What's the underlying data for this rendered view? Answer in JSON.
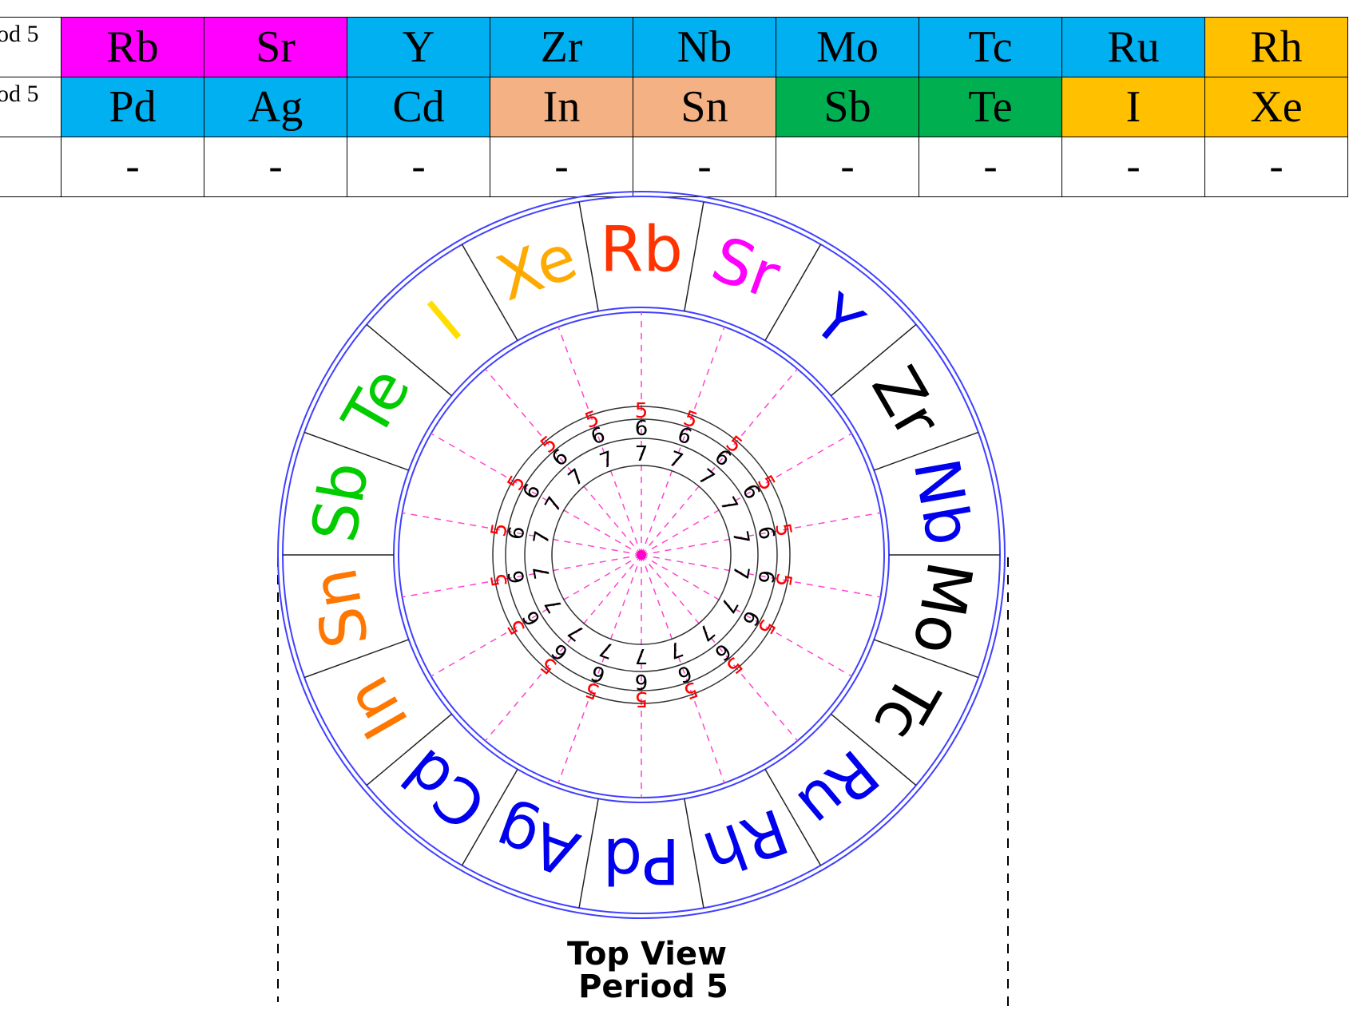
{
  "table": {
    "rows": [
      {
        "label": "od 5",
        "cells": [
          {
            "text": "Rb",
            "color": "#ff00ff"
          },
          {
            "text": "Sr",
            "color": "#ff00ff"
          },
          {
            "text": "Y",
            "color": "#00b0f0"
          },
          {
            "text": "Zr",
            "color": "#00b0f0"
          },
          {
            "text": "Nb",
            "color": "#00b0f0"
          },
          {
            "text": "Mo",
            "color": "#00b0f0"
          },
          {
            "text": "Tc",
            "color": "#00b0f0"
          },
          {
            "text": "Ru",
            "color": "#00b0f0"
          },
          {
            "text": "Rh",
            "color": "#ffc000"
          }
        ]
      },
      {
        "label": "od 5",
        "cells": [
          {
            "text": "Pd",
            "color": "#00b0f0"
          },
          {
            "text": "Ag",
            "color": "#00b0f0"
          },
          {
            "text": "Cd",
            "color": "#00b0f0"
          },
          {
            "text": "In",
            "color": "#f4b183"
          },
          {
            "text": "Sn",
            "color": "#f4b183"
          },
          {
            "text": "Sb",
            "color": "#00b050"
          },
          {
            "text": "Te",
            "color": "#00b050"
          },
          {
            "text": "I",
            "color": "#ffc000"
          },
          {
            "text": "Xe",
            "color": "#ffc000"
          }
        ]
      },
      {
        "label": "",
        "cells": [
          {
            "text": "-",
            "color": "#ffffff"
          },
          {
            "text": "-",
            "color": "#ffffff"
          },
          {
            "text": "-",
            "color": "#ffffff"
          },
          {
            "text": "-",
            "color": "#ffffff"
          },
          {
            "text": "-",
            "color": "#ffffff"
          },
          {
            "text": "-",
            "color": "#ffffff"
          },
          {
            "text": "-",
            "color": "#ffffff"
          },
          {
            "text": "-",
            "color": "#ffffff"
          },
          {
            "text": "-",
            "color": "#ffffff"
          }
        ]
      }
    ]
  },
  "wheel": {
    "elements": [
      {
        "symbol": "Rb",
        "color": "#ff3300"
      },
      {
        "symbol": "Sr",
        "color": "#ff00ff"
      },
      {
        "symbol": "Y",
        "color": "#0000ee"
      },
      {
        "symbol": "Zr",
        "color": "#000000"
      },
      {
        "symbol": "Nb",
        "color": "#0000ee"
      },
      {
        "symbol": "Mo",
        "color": "#000000"
      },
      {
        "symbol": "Tc",
        "color": "#000000"
      },
      {
        "symbol": "Ru",
        "color": "#0000ee"
      },
      {
        "symbol": "Rh",
        "color": "#0000ee"
      },
      {
        "symbol": "Pd",
        "color": "#0000ee"
      },
      {
        "symbol": "Ag",
        "color": "#0000ee"
      },
      {
        "symbol": "Cd",
        "color": "#0000ee"
      },
      {
        "symbol": "In",
        "color": "#ff7700"
      },
      {
        "symbol": "Sn",
        "color": "#ff7700"
      },
      {
        "symbol": "Sb",
        "color": "#00cc00"
      },
      {
        "symbol": "Te",
        "color": "#00cc00"
      },
      {
        "symbol": "I",
        "color": "#ffdd00"
      },
      {
        "symbol": "Xe",
        "color": "#ffaa00"
      }
    ],
    "rings": [
      {
        "number": "5",
        "color": "#ff0000"
      },
      {
        "number": "6",
        "color": "#000000"
      },
      {
        "number": "7",
        "color": "#000000"
      }
    ],
    "caption_line1": "Top View",
    "caption_line2": "Period 5"
  }
}
